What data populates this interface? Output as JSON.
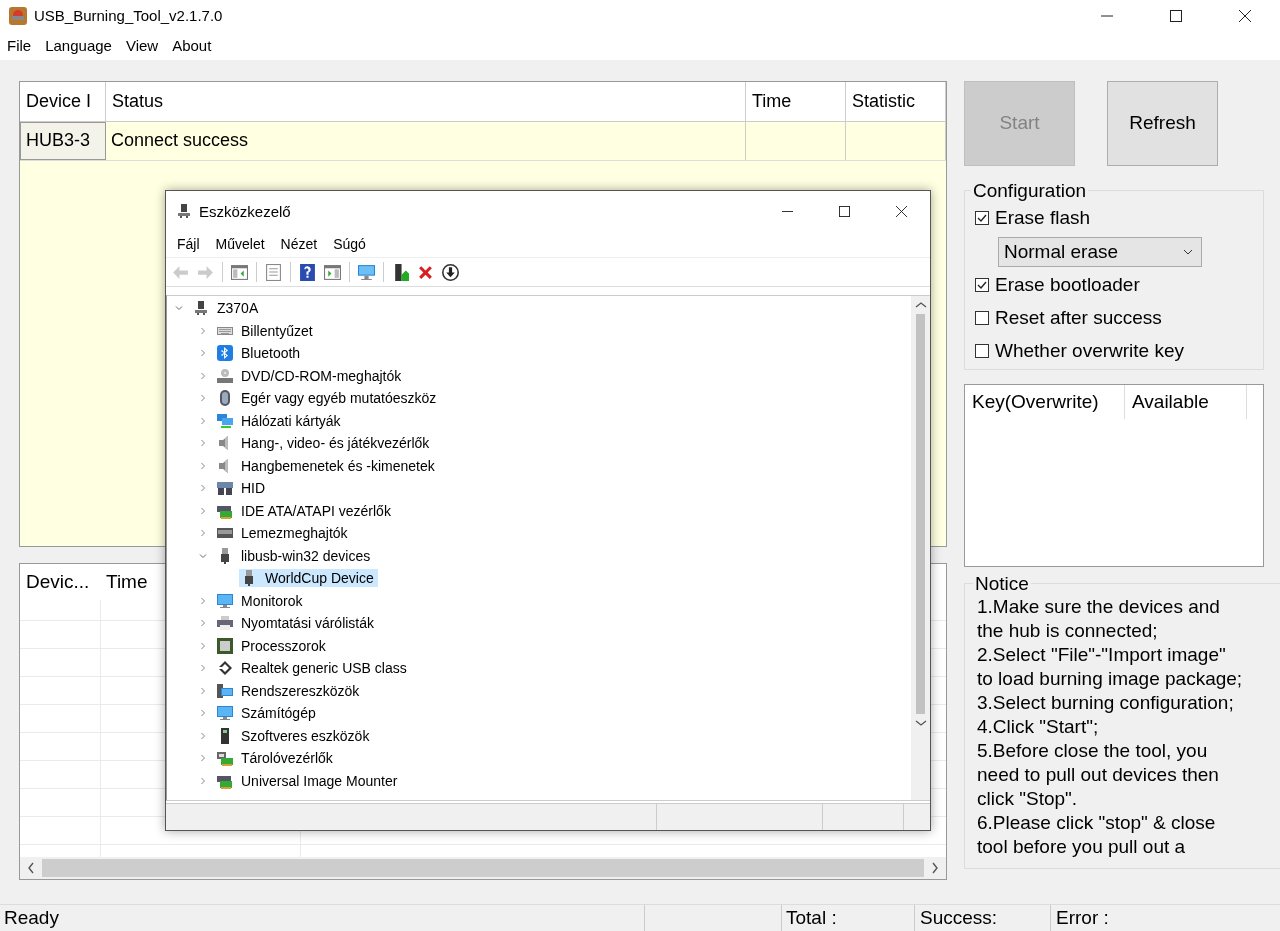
{
  "window": {
    "title": "USB_Burning_Tool_v2.1.7.0"
  },
  "menu": [
    "File",
    "Language",
    "View",
    "About"
  ],
  "device_table": {
    "columns": [
      "Device I",
      "Status",
      "Time",
      "Statistic"
    ],
    "rows": [
      {
        "cells": [
          "HUB3-3",
          "Connect success",
          "",
          ""
        ]
      }
    ]
  },
  "log_table": {
    "columns": [
      "Devic...",
      "Time"
    ]
  },
  "buttons": [
    {
      "label": "Start",
      "disabled": true
    },
    {
      "label": "Refresh",
      "disabled": false
    }
  ],
  "configuration": {
    "title": "Configuration",
    "items": [
      {
        "kind": "checkbox",
        "label": "Erase flash",
        "checked": true
      },
      {
        "kind": "dropdown",
        "value": "Normal erase"
      },
      {
        "kind": "checkbox",
        "label": "Erase bootloader",
        "checked": true
      },
      {
        "kind": "checkbox",
        "label": "Reset after success",
        "checked": false
      },
      {
        "kind": "checkbox",
        "label": "Whether overwrite key",
        "checked": false
      }
    ]
  },
  "key_table": {
    "columns": [
      "Key(Overwrite)",
      "Available"
    ]
  },
  "notice": {
    "title": "Notice",
    "lines": [
      "1.Make sure the devices and",
      "the hub is connected;",
      "2.Select \"File\"-\"Import image\"",
      "to load burning image package;",
      "3.Select burning configuration;",
      "4.Click \"Start\";",
      "5.Before close the tool, you",
      "need to pull out devices then",
      "click \"Stop\".",
      "6.Please click \"stop\" & close",
      "tool before you pull out a"
    ]
  },
  "status_bar": [
    "Ready",
    "Total :",
    "Success:",
    "Error :"
  ],
  "device_manager": {
    "title": "Eszközkezelő",
    "menu": [
      "Fájl",
      "Művelet",
      "Nézet",
      "Súgó"
    ],
    "toolbar_groups": [
      {
        "buttons": [
          {
            "kind": "back",
            "disabled": true
          },
          {
            "kind": "forward",
            "disabled": true
          }
        ]
      },
      {
        "buttons": [
          {
            "kind": "pane",
            "disabled": false
          }
        ]
      },
      {
        "buttons": [
          {
            "kind": "sheet",
            "disabled": false
          }
        ]
      },
      {
        "buttons": [
          {
            "kind": "help",
            "disabled": false
          },
          {
            "kind": "pane2",
            "disabled": false
          }
        ]
      },
      {
        "buttons": [
          {
            "kind": "monitor",
            "disabled": false
          }
        ]
      },
      {
        "buttons": [
          {
            "kind": "update",
            "disabled": false
          },
          {
            "kind": "remove",
            "disabled": false
          },
          {
            "kind": "download",
            "disabled": false
          }
        ]
      }
    ],
    "tree": [
      {
        "label": "Z370A",
        "kind": "computer",
        "expanded": true,
        "selected": false,
        "children": [
          {
            "label": "Billentyűzet",
            "kind": "keyboard",
            "expanded": false,
            "selected": false
          },
          {
            "label": "Bluetooth",
            "kind": "bluetooth",
            "expanded": false,
            "selected": false
          },
          {
            "label": "DVD/CD-ROM-meghajtók",
            "kind": "disc",
            "expanded": false,
            "selected": false
          },
          {
            "label": "Egér vagy egyéb mutatóeszköz",
            "kind": "mouse",
            "expanded": false,
            "selected": false
          },
          {
            "label": "Hálózati kártyák",
            "kind": "network",
            "expanded": false,
            "selected": false
          },
          {
            "label": "Hang-, video- és játékvezérlők",
            "kind": "speaker",
            "expanded": false,
            "selected": false
          },
          {
            "label": "Hangbemenetek és -kimenetek",
            "kind": "speaker",
            "expanded": false,
            "selected": false
          },
          {
            "label": "HID",
            "kind": "gamepad",
            "expanded": false,
            "selected": false
          },
          {
            "label": "IDE ATA/ATAPI vezérlők",
            "kind": "card",
            "expanded": false,
            "selected": false
          },
          {
            "label": "Lemezmeghajtók",
            "kind": "drive",
            "expanded": false,
            "selected": false
          },
          {
            "label": "libusb-win32 devices",
            "kind": "plug",
            "expanded": true,
            "selected": false,
            "children": [
              {
                "label": "WorldCup Device",
                "kind": "plug",
                "selected": true
              }
            ]
          },
          {
            "label": "Monitorok",
            "kind": "monitor",
            "expanded": false,
            "selected": false
          },
          {
            "label": "Nyomtatási várólisták",
            "kind": "printer",
            "expanded": false,
            "selected": false
          },
          {
            "label": "Processzorok",
            "kind": "chip",
            "expanded": false,
            "selected": false
          },
          {
            "label": "Realtek generic USB class",
            "kind": "chevron",
            "expanded": false,
            "selected": false
          },
          {
            "label": "Rendszereszközök",
            "kind": "system",
            "expanded": false,
            "selected": false
          },
          {
            "label": "Számítógép",
            "kind": "monitor",
            "expanded": false,
            "selected": false
          },
          {
            "label": "Szoftveres eszközök",
            "kind": "tower",
            "expanded": false,
            "selected": false
          },
          {
            "label": "Tárolóvezérlők",
            "kind": "storage",
            "expanded": false,
            "selected": false
          },
          {
            "label": "Universal Image Mounter",
            "kind": "card",
            "expanded": false,
            "selected": false
          }
        ]
      }
    ]
  }
}
